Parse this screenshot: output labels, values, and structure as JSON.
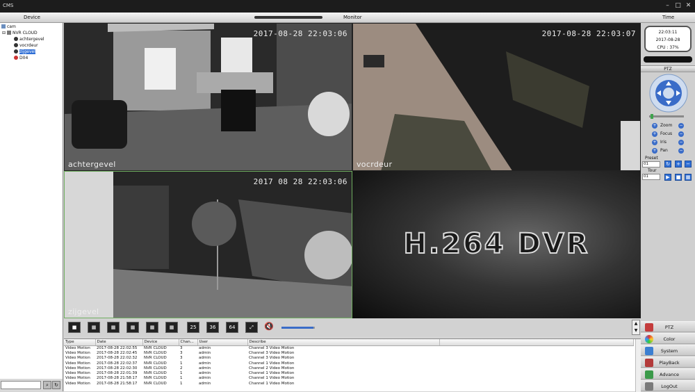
{
  "window": {
    "title": "CMS"
  },
  "headers": {
    "device": "Device",
    "monitor": "Monitor",
    "time": "Time"
  },
  "tree": {
    "root": "cam",
    "group": "NVR CLOUD",
    "channels": [
      "achtergevel",
      "vocrdeur",
      "zijgevel",
      "D04"
    ],
    "selected": "zijgevel"
  },
  "cameras": [
    {
      "name": "achtergevel",
      "timestamp": "2017-08-28 22:03:06"
    },
    {
      "name": "vocrdeur",
      "timestamp": "2017-08-28 22:03:07"
    },
    {
      "name": "zijgevel",
      "timestamp": "2017 08 28 22:03:06"
    },
    {
      "name": "",
      "timestamp": "",
      "placeholder": "H.264 DVR"
    }
  ],
  "layout_buttons": [
    "25",
    "36",
    "64"
  ],
  "log": {
    "columns": [
      "Type",
      "Date",
      "Device",
      "Chan...",
      "User",
      "Describe"
    ],
    "rows": [
      [
        "Video Motion",
        "2017-08-28 22:02:55",
        "NVR CLOUD",
        "3",
        "admin",
        "Channel 3 Video Motion"
      ],
      [
        "Video Motion",
        "2017-08-28 22:02:45",
        "NVR CLOUD",
        "3",
        "admin",
        "Channel 3 Video Motion"
      ],
      [
        "Video Motion",
        "2017-08-28 22:02:32",
        "NVR CLOUD",
        "3",
        "admin",
        "Channel 3 Video Motion"
      ],
      [
        "Video Motion",
        "2017-08-28 22:02:37",
        "NVR CLOUD",
        "1",
        "admin",
        "Channel 1 Video Motion"
      ],
      [
        "Video Motion",
        "2017-08-28 22:02:30",
        "NVR CLOUD",
        "2",
        "admin",
        "Channel 2 Video Motion"
      ],
      [
        "Video Motion",
        "2017-08-28 22:01:39",
        "NVR CLOUD",
        "1",
        "admin",
        "Channel 1 Video Motion"
      ],
      [
        "Video Motion",
        "2017-08-28 21:58:17",
        "NVR CLOUD",
        "1",
        "admin",
        "Channel 1 Video Motion"
      ],
      [
        "Video Motion",
        "2017-08-28 21:58:17",
        "NVR CLOUD",
        "1",
        "admin",
        "Channel 1 Video Motion"
      ]
    ]
  },
  "clock": {
    "time": "22:03:11",
    "date": "2017-08-28",
    "cpu": "CPU : 37%"
  },
  "ptz": {
    "header": "PTZ",
    "controls": [
      "Zoom",
      "Focus",
      "Iris",
      "Pan"
    ],
    "preset_label": "Preset",
    "preset_value": "01",
    "tour_label": "Tour",
    "tour_value": "01"
  },
  "nav": [
    "PTZ",
    "Color",
    "System",
    "PlayBack",
    "Advance",
    "LogOut"
  ],
  "colors": {
    "selection": "#2f6fd6",
    "accent": "#3a6cc8",
    "selected_frame": "#6fae5f"
  }
}
